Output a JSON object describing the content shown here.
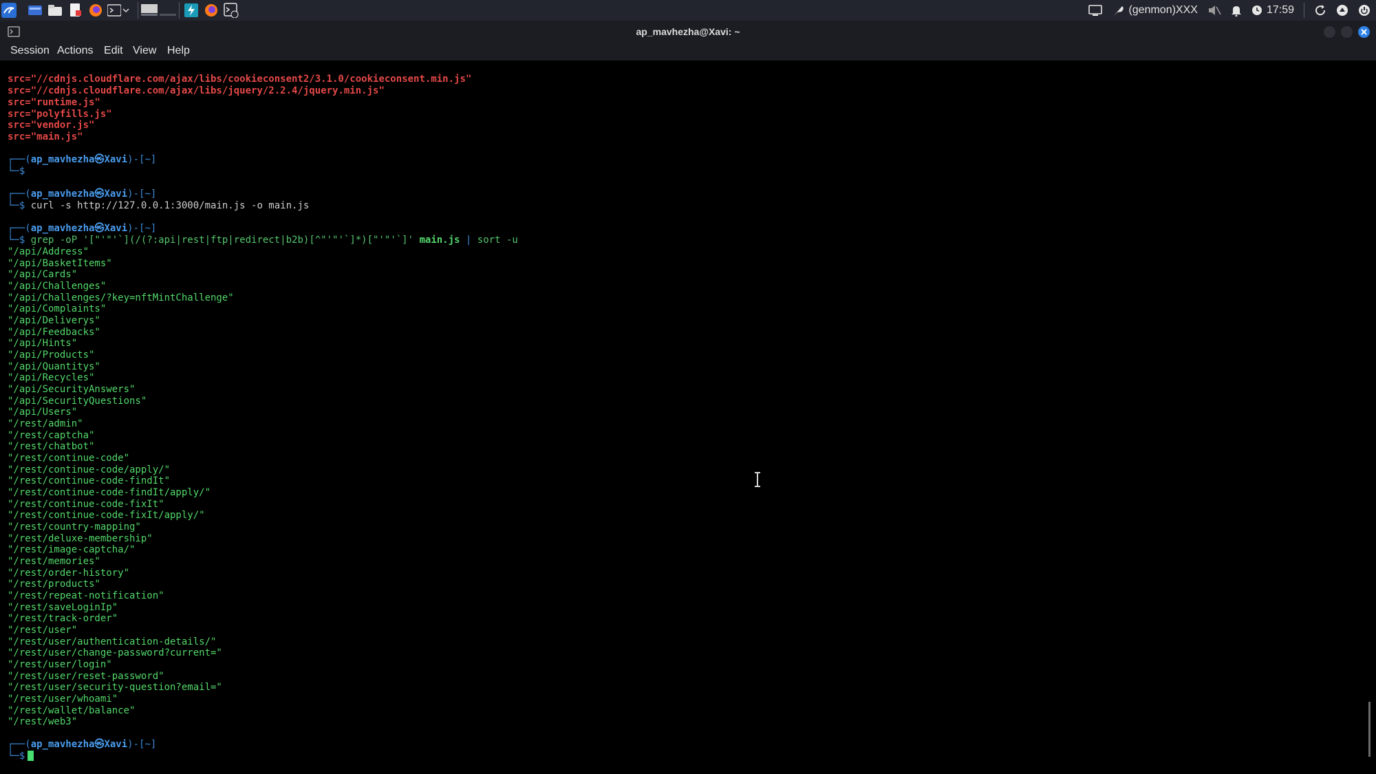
{
  "panel": {
    "status_text": "(genmon)XXX",
    "clock": "17:59",
    "icons": [
      "kali-menu-icon",
      "workspace-icon",
      "file-manager-icon",
      "text-editor-icon",
      "firefox-icon",
      "terminal-icon",
      "workspace-preview-icon",
      "app-launcher-icon",
      "firefox-icon",
      "terminal-icon"
    ]
  },
  "window": {
    "title": "ap_mavhezha@Xavi: ~"
  },
  "menu": [
    "Session",
    "Actions",
    "Edit",
    "View",
    "Help"
  ],
  "terminal": {
    "src_lines": [
      "src=\"//cdnjs.cloudflare.com/ajax/libs/cookieconsent2/3.1.0/cookieconsent.min.js\"",
      "src=\"//cdnjs.cloudflare.com/ajax/libs/jquery/2.2.4/jquery.min.js\"",
      "src=\"runtime.js\"",
      "src=\"polyfills.js\"",
      "src=\"vendor.js\"",
      "src=\"main.js\""
    ],
    "prompt": {
      "frame_top": "┌──(",
      "user": "ap_mavhezha",
      "at": "㉿",
      "host": "Xavi",
      "cwd_part": ")-[~]",
      "frame_bottom": "└─$"
    },
    "commands": {
      "curl": "curl -s http://127.0.0.1:3000/main.js -o main.js",
      "grep_a": "grep -oP '[\"'\"'`](/(?:api|rest|ftp|redirect|b2b)[^\"'\"'`]*)[\"'\"'`]'",
      "grep_file": "main.js",
      "grep_pipe": "|",
      "grep_sort": "sort -u"
    },
    "output_lines": [
      "\"/api/Address\"",
      "\"/api/BasketItems\"",
      "\"/api/Cards\"",
      "\"/api/Challenges\"",
      "\"/api/Challenges/?key=nftMintChallenge\"",
      "\"/api/Complaints\"",
      "\"/api/Deliverys\"",
      "\"/api/Feedbacks\"",
      "\"/api/Hints\"",
      "\"/api/Products\"",
      "\"/api/Quantitys\"",
      "\"/api/Recycles\"",
      "\"/api/SecurityAnswers\"",
      "\"/api/SecurityQuestions\"",
      "\"/api/Users\"",
      "\"/rest/admin\"",
      "\"/rest/captcha\"",
      "\"/rest/chatbot\"",
      "\"/rest/continue-code\"",
      "\"/rest/continue-code/apply/\"",
      "\"/rest/continue-code-findIt\"",
      "\"/rest/continue-code-findIt/apply/\"",
      "\"/rest/continue-code-fixIt\"",
      "\"/rest/continue-code-fixIt/apply/\"",
      "\"/rest/country-mapping\"",
      "\"/rest/deluxe-membership\"",
      "\"/rest/image-captcha/\"",
      "\"/rest/memories\"",
      "\"/rest/order-history\"",
      "\"/rest/products\"",
      "\"/rest/repeat-notification\"",
      "\"/rest/saveLoginIp\"",
      "\"/rest/track-order\"",
      "\"/rest/user\"",
      "\"/rest/user/authentication-details/\"",
      "\"/rest/user/change-password?current=\"",
      "\"/rest/user/login\"",
      "\"/rest/user/reset-password\"",
      "\"/rest/user/security-question?email=\"",
      "\"/rest/user/whoami\"",
      "\"/rest/wallet/balance\"",
      "\"/rest/web3\""
    ]
  }
}
